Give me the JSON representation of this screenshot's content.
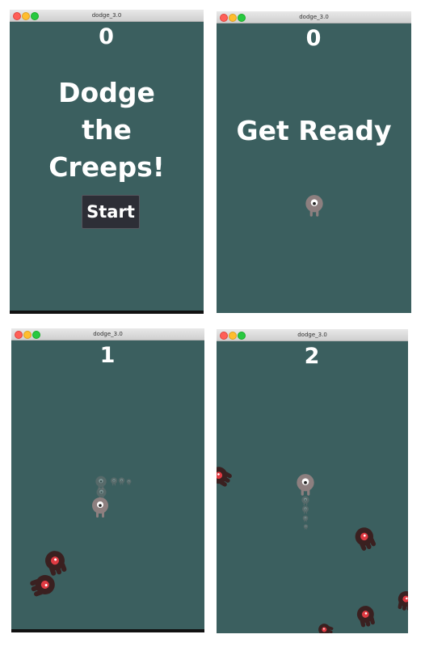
{
  "window_title": "dodge_3.0",
  "panels": [
    {
      "score": "0",
      "message": "Dodge\nthe\nCreeps!",
      "start_label": "Start"
    },
    {
      "score": "0",
      "message": "Get Ready"
    },
    {
      "score": "1"
    },
    {
      "score": "2"
    }
  ],
  "colors": {
    "background": "#3b5f5f",
    "text": "#ffffff",
    "button_bg": "#2d2e36",
    "player": "#8d7f7f",
    "creep": "#3a2020",
    "creep_eye": "#e03a42"
  },
  "icons": [
    "player-sprite-icon",
    "creep-enemy-icon",
    "player-trail-icon"
  ]
}
